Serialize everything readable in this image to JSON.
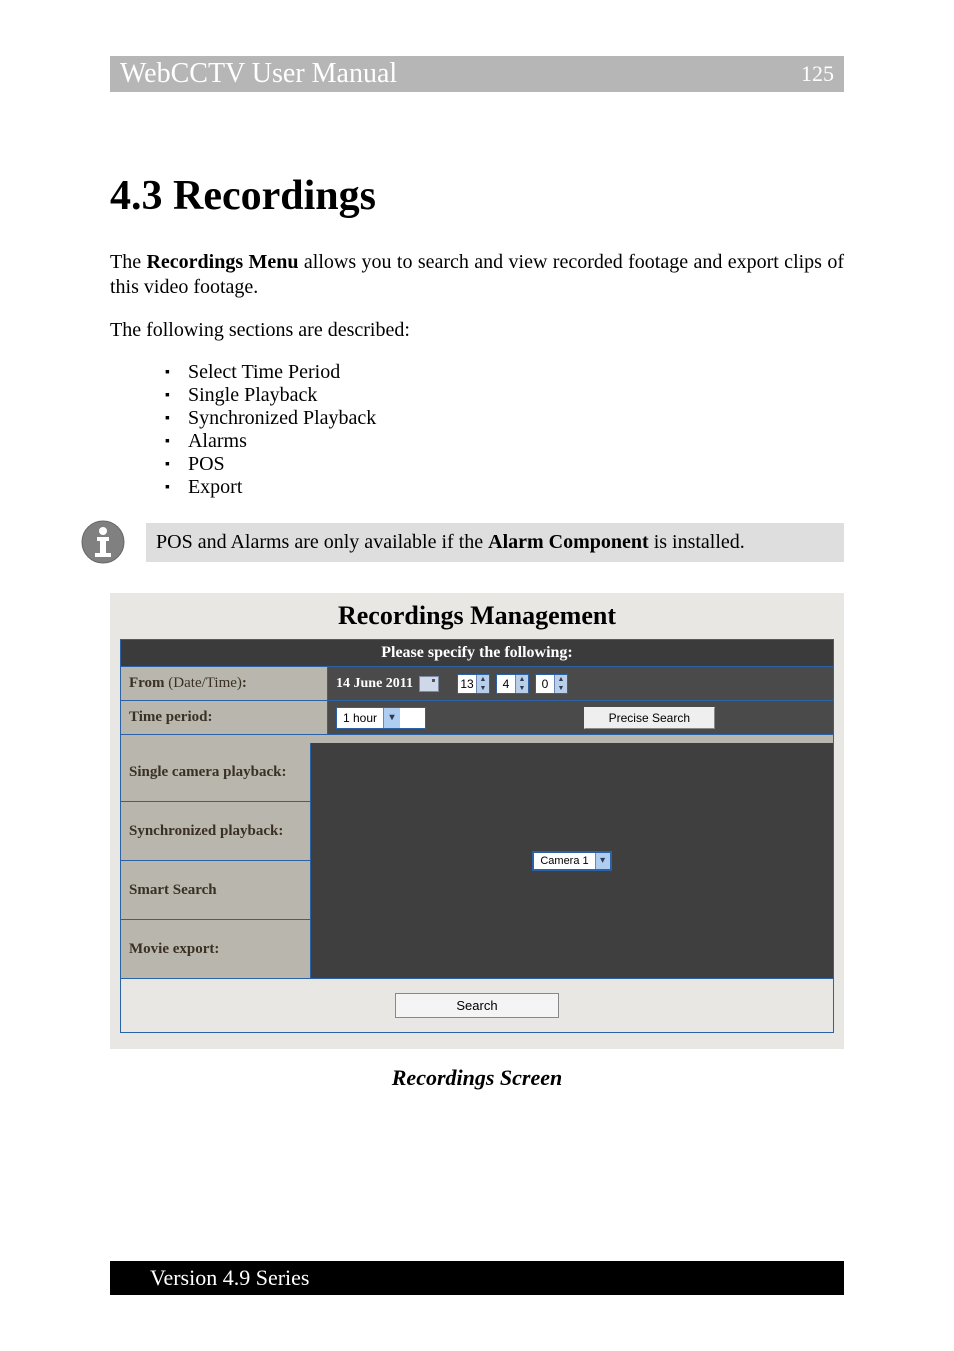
{
  "header": {
    "title": "WebCCTV User Manual",
    "page_number": "125"
  },
  "section": {
    "title": "4.3 Recordings",
    "intro_pre": "The ",
    "intro_bold": "Recordings Menu",
    "intro_post": " allows you to search and view recorded footage and export clips of this video footage.",
    "following": "The following sections are described:",
    "items": [
      "Select Time Period",
      "Single Playback",
      "Synchronized Playback",
      "Alarms",
      "POS",
      "Export"
    ],
    "note_pre": "POS and Alarms are only available if the ",
    "note_bold": "Alarm Component",
    "note_post": " is installed."
  },
  "screenshot": {
    "title": "Recordings Management",
    "specify_header": "Please specify the following:",
    "from_label": "From (Date/Time):",
    "from_date": "14 June 2011",
    "hour": "13",
    "minute": "4",
    "second": "0",
    "time_period_label": "Time period:",
    "time_period_value": "1 hour",
    "precise_btn": "Precise Search",
    "rows": {
      "single": "Single camera playback:",
      "sync": "Synchronized playback:",
      "smart": "Smart Search",
      "movie": "Movie export:"
    },
    "camera_value": "Camera 1",
    "search_btn": "Search",
    "caption": "Recordings Screen"
  },
  "footer": {
    "version": "Version 4.9 Series"
  }
}
